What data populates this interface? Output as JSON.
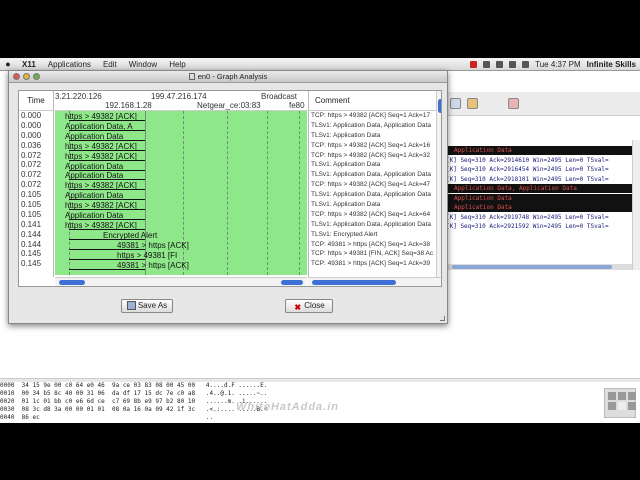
{
  "menubar": {
    "app": "X11",
    "items": [
      "Applications",
      "Edit",
      "Window",
      "Help"
    ],
    "clock": "Tue 4:37 PM",
    "user": "Infinite Skills"
  },
  "window": {
    "title": "en0 - Graph Analysis",
    "save_label": "Save As",
    "close_label": "Close"
  },
  "graph": {
    "time_header": "Time",
    "comment_header": "Comment",
    "hosts_top": [
      "3.21.220.126",
      "199.47.216.174",
      "Broadcast"
    ],
    "hosts_bottom": [
      "192.168.1.28",
      "Netgear_ce:03:83",
      "fe80"
    ],
    "times": [
      "0.000",
      "0.000",
      "0.000",
      "0.036",
      "0.072",
      "0.072",
      "0.072",
      "0.072",
      "0.105",
      "0.105",
      "0.105",
      "0.141",
      "0.144",
      "0.144",
      "0.145",
      "0.145"
    ],
    "flows": [
      "https > 49382 [ACK]",
      "Application Data, A",
      "Application Data",
      "https > 49382 [ACK]",
      "https > 49382 [ACK]",
      "Application Data",
      "Application Data",
      "https > 49382 [ACK]",
      "Application Data",
      "https > 49382 [ACK]",
      "Application Data",
      "https > 49382 [ACK]",
      "Encrypted Alert",
      "49381 > https [ACK]",
      "https > 49381 [FI",
      "49381 > https [ACK]"
    ],
    "comments": [
      "TCP: https > 49382 [ACK] Seq=1 Ack=17",
      "TLSv1: Application Data, Application Data",
      "TLSv1: Application Data",
      "TCP: https > 49382 [ACK] Seq=1 Ack=16",
      "TCP: https > 49382 [ACK] Seq=1 Ack=32",
      "TLSv1: Application Data",
      "TLSv1: Application Data, Application Data",
      "TCP: https > 49382 [ACK] Seq=1 Ack=47",
      "TLSv1: Application Data, Application Data",
      "TLSv1: Application Data",
      "TCP: https > 49382 [ACK] Seq=1 Ack=64",
      "TLSv1: Application Data, Application Data",
      "TLSv1: Encrypted Alert",
      "TCP: 49381 > https [ACK] Seq=1 Ack=38",
      "TCP: https > 49381 [FIN, ACK] Seq=38 Ac",
      "TCP: 49381 > https [ACK] Seq=1 Ack=39"
    ]
  },
  "background_packets": [
    {
      "style": "dark",
      "text": "Application Data"
    },
    {
      "style": "light",
      "text": "[K] Seq=310 Ack=2914610 Win=2495 Len=0 TSval="
    },
    {
      "style": "light",
      "text": "[K] Seq=310 Ack=2916454 Win=2495 Len=0 TSval="
    },
    {
      "style": "light",
      "text": "[K] Seq=310 Ack=2918101 Win=2495 Len=0 TSval="
    },
    {
      "style": "dark",
      "text": "Application Data, Application Data"
    },
    {
      "style": "dark",
      "text": "Application Data"
    },
    {
      "style": "dark",
      "text": "Application Data"
    },
    {
      "style": "light",
      "text": "[K] Seq=310 Ack=2919748 Win=2495 Len=0 TSval="
    },
    {
      "style": "light",
      "text": "[K] Seq=310 Ack=2921592 Win=2495 Len=0 TSval="
    }
  ],
  "hex_dump": [
    "0000  34 15 9e 00 c0 64 e0 46  9a ce 03 83 08 00 45 00   4....d.F ......E.",
    "0010  00 34 b5 8c 40 00 31 06  da df 17 15 dc 7e c0 a8   .4..@.1. .....~..",
    "0020  01 1c 01 bb c0 e6 6d ce  c7 69 8b e9 97 b2 80 10   ......m. .i......",
    "0030  08 3c d8 3a 00 00 01 01  08 0a 16 0a 09 42 1f 3c   .<.:.... .....B.<",
    "0040  86 ec                                              .."
  ],
  "watermark": "WhiteHatAdda.in"
}
